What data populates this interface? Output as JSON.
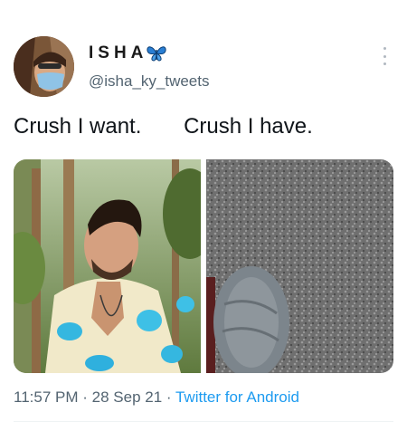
{
  "tweet": {
    "display_name": "ISHA",
    "handle": "@isha_ky_tweets",
    "text": "Crush I want.       Crush I have.",
    "time": "11:57 PM",
    "date": "28 Sep 21",
    "source": "Twitter for Android"
  },
  "colors": {
    "link": "#1d9bf0",
    "muted": "#536471",
    "butterfly": "#2a7fd4"
  },
  "icons": {
    "name_emoji": "butterfly-icon",
    "menu": "more-options-icon"
  }
}
